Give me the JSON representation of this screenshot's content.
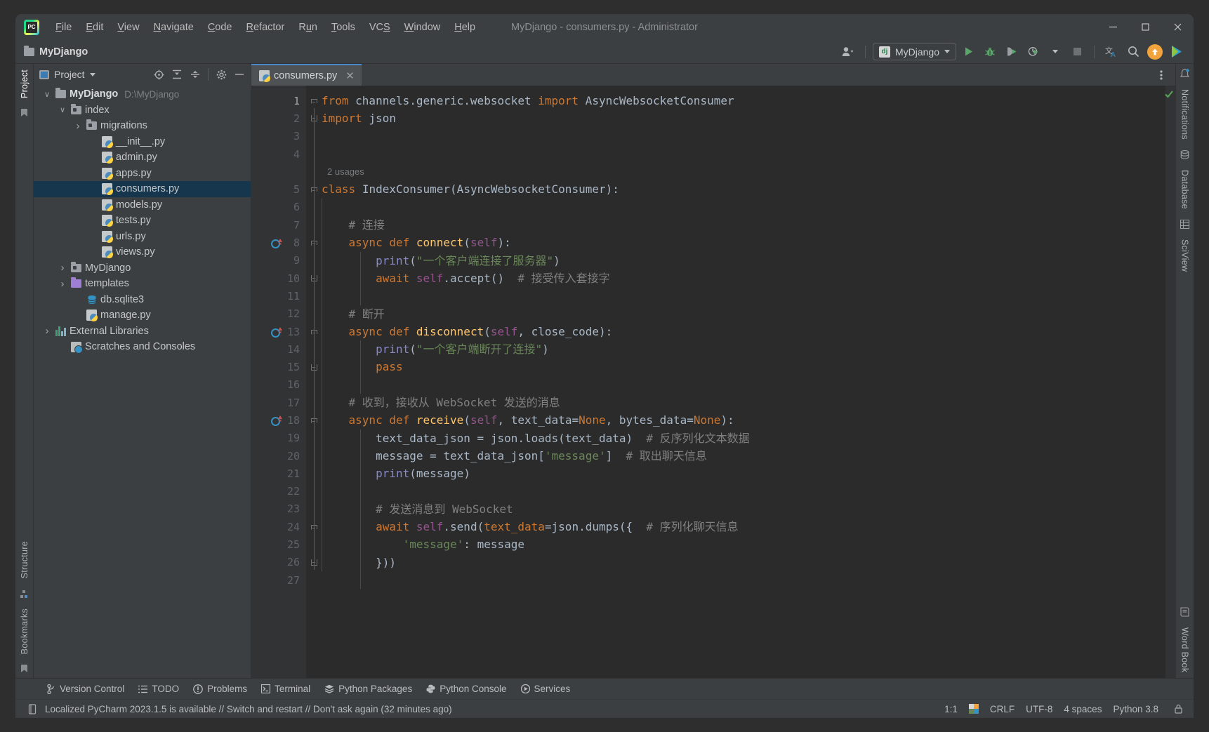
{
  "window": {
    "title": "MyDjango - consumers.py - Administrator",
    "logo_text": "PC",
    "minimize_label": "─",
    "maximize_label": "□",
    "close_label": "✕"
  },
  "menubar": [
    {
      "label": "File",
      "mnemonic": "F"
    },
    {
      "label": "Edit",
      "mnemonic": "E"
    },
    {
      "label": "View",
      "mnemonic": "V"
    },
    {
      "label": "Navigate",
      "mnemonic": "N"
    },
    {
      "label": "Code",
      "mnemonic": "C"
    },
    {
      "label": "Refactor",
      "mnemonic": "R"
    },
    {
      "label": "Run",
      "mnemonic": "u"
    },
    {
      "label": "Tools",
      "mnemonic": "T"
    },
    {
      "label": "VCS",
      "mnemonic": "S"
    },
    {
      "label": "Window",
      "mnemonic": "W"
    },
    {
      "label": "Help",
      "mnemonic": "H"
    }
  ],
  "toolbar": {
    "breadcrumb": "MyDjango",
    "run_config": "MyDjango",
    "run_config_icon": "dj",
    "icons": [
      "user-avatar-icon",
      "run-icon",
      "debug-icon",
      "run-with-coverage-icon",
      "profile-icon",
      "stop-icon",
      "translate-icon",
      "search-everywhere-icon",
      "update-available-icon",
      "ide-services-icon"
    ]
  },
  "left_rail": {
    "tabs": [
      "Project",
      "Structure",
      "Bookmarks"
    ],
    "active": "Project"
  },
  "right_rail": {
    "tabs": [
      "Notifications",
      "Database",
      "SciView",
      "Word Book"
    ]
  },
  "project_panel": {
    "title": "Project",
    "header_icons": [
      "select-opened-file-icon",
      "expand-all-icon",
      "collapse-all-icon",
      "settings-gear-icon",
      "hide-icon"
    ],
    "tree": [
      {
        "label": "MyDjango",
        "path": "D:\\MyDjango",
        "icon": "folder-icon",
        "indent": 0,
        "chevron": "down",
        "bold": true,
        "selected": false
      },
      {
        "label": "index",
        "path": "",
        "icon": "module-folder-icon",
        "indent": 1,
        "chevron": "down",
        "bold": false,
        "selected": false
      },
      {
        "label": "migrations",
        "path": "",
        "icon": "module-folder-icon",
        "indent": 2,
        "chevron": "right",
        "bold": false,
        "selected": false
      },
      {
        "label": "__init__.py",
        "path": "",
        "icon": "python-file-icon",
        "indent": 3,
        "chevron": "none",
        "bold": false,
        "selected": false
      },
      {
        "label": "admin.py",
        "path": "",
        "icon": "python-file-icon",
        "indent": 3,
        "chevron": "none",
        "bold": false,
        "selected": false
      },
      {
        "label": "apps.py",
        "path": "",
        "icon": "python-file-icon",
        "indent": 3,
        "chevron": "none",
        "bold": false,
        "selected": false
      },
      {
        "label": "consumers.py",
        "path": "",
        "icon": "python-file-icon",
        "indent": 3,
        "chevron": "none",
        "bold": false,
        "selected": true
      },
      {
        "label": "models.py",
        "path": "",
        "icon": "python-file-icon",
        "indent": 3,
        "chevron": "none",
        "bold": false,
        "selected": false
      },
      {
        "label": "tests.py",
        "path": "",
        "icon": "python-file-icon",
        "indent": 3,
        "chevron": "none",
        "bold": false,
        "selected": false
      },
      {
        "label": "urls.py",
        "path": "",
        "icon": "python-file-icon",
        "indent": 3,
        "chevron": "none",
        "bold": false,
        "selected": false
      },
      {
        "label": "views.py",
        "path": "",
        "icon": "python-file-icon",
        "indent": 3,
        "chevron": "none",
        "bold": false,
        "selected": false
      },
      {
        "label": "MyDjango",
        "path": "",
        "icon": "module-folder-icon",
        "indent": 1,
        "chevron": "right",
        "bold": false,
        "selected": false
      },
      {
        "label": "templates",
        "path": "",
        "icon": "templates-folder-icon",
        "indent": 1,
        "chevron": "right",
        "bold": false,
        "selected": false
      },
      {
        "label": "db.sqlite3",
        "path": "",
        "icon": "database-file-icon",
        "indent": 2,
        "chevron": "none",
        "bold": false,
        "selected": false
      },
      {
        "label": "manage.py",
        "path": "",
        "icon": "python-file-icon",
        "indent": 2,
        "chevron": "none",
        "bold": false,
        "selected": false
      },
      {
        "label": "External Libraries",
        "path": "",
        "icon": "external-libraries-icon",
        "indent": 0,
        "chevron": "right",
        "bold": false,
        "selected": false
      },
      {
        "label": "Scratches and Consoles",
        "path": "",
        "icon": "scratches-icon",
        "indent": 1,
        "chevron": "none",
        "bold": false,
        "selected": false
      }
    ]
  },
  "editor": {
    "tab": {
      "label": "consumers.py",
      "icon": "python-file-icon",
      "close": "✕"
    },
    "inspection_status": "ok-checkmark-icon",
    "usages_hint": "2 usages",
    "total_lines": 27,
    "lines": [
      {
        "n": 1,
        "gutter": "",
        "fold": "open",
        "tokens": [
          [
            "kw",
            "from"
          ],
          [
            "par",
            " channels.generic.websocket "
          ],
          [
            "kw",
            "import"
          ],
          [
            "par",
            " AsyncWebsocketConsumer"
          ]
        ]
      },
      {
        "n": 2,
        "gutter": "",
        "fold": "end",
        "tokens": [
          [
            "kw",
            "import"
          ],
          [
            "par",
            " json"
          ]
        ]
      },
      {
        "n": 3,
        "gutter": "",
        "fold": "",
        "tokens": []
      },
      {
        "n": 4,
        "gutter": "",
        "fold": "",
        "tokens": []
      },
      {
        "n": 5,
        "gutter": "",
        "fold": "open",
        "tokens": [
          [
            "kw",
            "class"
          ],
          [
            "par",
            " "
          ],
          [
            "cls",
            "IndexConsumer"
          ],
          [
            "par",
            "(AsyncWebsocketConsumer):"
          ]
        ]
      },
      {
        "n": 6,
        "gutter": "",
        "fold": "",
        "tokens": []
      },
      {
        "n": 7,
        "gutter": "",
        "fold": "",
        "tokens": [
          [
            "par",
            "    "
          ],
          [
            "cmt",
            "# 连接"
          ]
        ]
      },
      {
        "n": 8,
        "gutter": "override",
        "fold": "open",
        "tokens": [
          [
            "par",
            "    "
          ],
          [
            "kw",
            "async def"
          ],
          [
            "par",
            " "
          ],
          [
            "fn",
            "connect"
          ],
          [
            "par",
            "("
          ],
          [
            "slf",
            "self"
          ],
          [
            "par",
            "):"
          ]
        ]
      },
      {
        "n": 9,
        "gutter": "",
        "fold": "",
        "tokens": [
          [
            "par",
            "        "
          ],
          [
            "bi",
            "print"
          ],
          [
            "par",
            "("
          ],
          [
            "str",
            "\"一个客户端连接了服务器\""
          ],
          [
            "par",
            ")"
          ]
        ]
      },
      {
        "n": 10,
        "gutter": "",
        "fold": "end",
        "tokens": [
          [
            "par",
            "        "
          ],
          [
            "kw",
            "await"
          ],
          [
            "par",
            " "
          ],
          [
            "slf",
            "self"
          ],
          [
            "par",
            "."
          ],
          [
            "par",
            "accept()"
          ],
          [
            "cmt",
            "  # 接受传入套接字"
          ]
        ]
      },
      {
        "n": 11,
        "gutter": "",
        "fold": "",
        "tokens": []
      },
      {
        "n": 12,
        "gutter": "",
        "fold": "",
        "tokens": [
          [
            "par",
            "    "
          ],
          [
            "cmt",
            "# 断开"
          ]
        ]
      },
      {
        "n": 13,
        "gutter": "override",
        "fold": "open",
        "tokens": [
          [
            "par",
            "    "
          ],
          [
            "kw",
            "async def"
          ],
          [
            "par",
            " "
          ],
          [
            "fn",
            "disconnect"
          ],
          [
            "par",
            "("
          ],
          [
            "slf",
            "self"
          ],
          [
            "par",
            ", close_code):"
          ]
        ]
      },
      {
        "n": 14,
        "gutter": "",
        "fold": "",
        "tokens": [
          [
            "par",
            "        "
          ],
          [
            "bi",
            "print"
          ],
          [
            "par",
            "("
          ],
          [
            "str",
            "\"一个客户端断开了连接\""
          ],
          [
            "par",
            ")"
          ]
        ]
      },
      {
        "n": 15,
        "gutter": "",
        "fold": "end",
        "tokens": [
          [
            "par",
            "        "
          ],
          [
            "kw",
            "pass"
          ]
        ]
      },
      {
        "n": 16,
        "gutter": "",
        "fold": "",
        "tokens": []
      },
      {
        "n": 17,
        "gutter": "",
        "fold": "",
        "tokens": [
          [
            "par",
            "    "
          ],
          [
            "cmt",
            "# 收到，接收从 WebSocket 发送的消息"
          ]
        ]
      },
      {
        "n": 18,
        "gutter": "override",
        "fold": "open",
        "tokens": [
          [
            "par",
            "    "
          ],
          [
            "kw",
            "async def"
          ],
          [
            "par",
            " "
          ],
          [
            "fn",
            "receive"
          ],
          [
            "par",
            "("
          ],
          [
            "slf",
            "self"
          ],
          [
            "par",
            ", text_data="
          ],
          [
            "cnst",
            "None"
          ],
          [
            "par",
            ", bytes_data="
          ],
          [
            "cnst",
            "None"
          ],
          [
            "par",
            "):"
          ]
        ]
      },
      {
        "n": 19,
        "gutter": "",
        "fold": "",
        "tokens": [
          [
            "par",
            "        text_data_json = json.loads(text_data)"
          ],
          [
            "cmt",
            "  # 反序列化文本数据"
          ]
        ]
      },
      {
        "n": 20,
        "gutter": "",
        "fold": "",
        "tokens": [
          [
            "par",
            "        message = text_data_json["
          ],
          [
            "str",
            "'message'"
          ],
          [
            "par",
            "]"
          ],
          [
            "cmt",
            "  # 取出聊天信息"
          ]
        ]
      },
      {
        "n": 21,
        "gutter": "",
        "fold": "",
        "tokens": [
          [
            "par",
            "        "
          ],
          [
            "bi",
            "print"
          ],
          [
            "par",
            "(message)"
          ]
        ]
      },
      {
        "n": 22,
        "gutter": "",
        "fold": "",
        "tokens": []
      },
      {
        "n": 23,
        "gutter": "",
        "fold": "",
        "tokens": [
          [
            "par",
            "        "
          ],
          [
            "cmt",
            "# 发送消息到 WebSocket"
          ]
        ]
      },
      {
        "n": 24,
        "gutter": "",
        "fold": "open",
        "tokens": [
          [
            "par",
            "        "
          ],
          [
            "kw",
            "await"
          ],
          [
            "par",
            " "
          ],
          [
            "slf",
            "self"
          ],
          [
            "par",
            ".send("
          ],
          [
            "kw2",
            "text_data"
          ],
          [
            "par",
            "=json.dumps({"
          ],
          [
            "cmt",
            "  # 序列化聊天信息"
          ]
        ]
      },
      {
        "n": 25,
        "gutter": "",
        "fold": "",
        "tokens": [
          [
            "par",
            "            "
          ],
          [
            "str",
            "'message'"
          ],
          [
            "par",
            ": message"
          ]
        ]
      },
      {
        "n": 26,
        "gutter": "",
        "fold": "end",
        "tokens": [
          [
            "par",
            "        }))"
          ]
        ]
      },
      {
        "n": 27,
        "gutter": "",
        "fold": "",
        "tokens": []
      }
    ]
  },
  "bottom_bar": [
    {
      "label": "Version Control",
      "icon": "branch-icon"
    },
    {
      "label": "TODO",
      "icon": "list-icon"
    },
    {
      "label": "Problems",
      "icon": "warning-icon"
    },
    {
      "label": "Terminal",
      "icon": "terminal-icon"
    },
    {
      "label": "Python Packages",
      "icon": "packages-icon"
    },
    {
      "label": "Python Console",
      "icon": "python-icon"
    },
    {
      "label": "Services",
      "icon": "services-icon"
    }
  ],
  "status_bar": {
    "icon": "notification-icon",
    "message": "Localized PyCharm 2023.1.5 is available // Switch and restart // Don't ask again (32 minutes ago)",
    "caret_position": "1:1",
    "line_separator": "CRLF",
    "encoding": "UTF-8",
    "indent": "4 spaces",
    "interpreter": "Python 3.8",
    "lock_icon": "lock-icon"
  },
  "colors": {
    "accent_blue": "#4a88c7",
    "selection_blue": "#16364d",
    "editor_bg": "#2b2b2b",
    "panel_bg": "#3c3f41",
    "run_green": "#59a869",
    "update_orange": "#f2a33c",
    "string_green": "#6a8759",
    "keyword_orange": "#cc7832",
    "function_yellow": "#ffc66d",
    "comment_grey": "#808080"
  }
}
